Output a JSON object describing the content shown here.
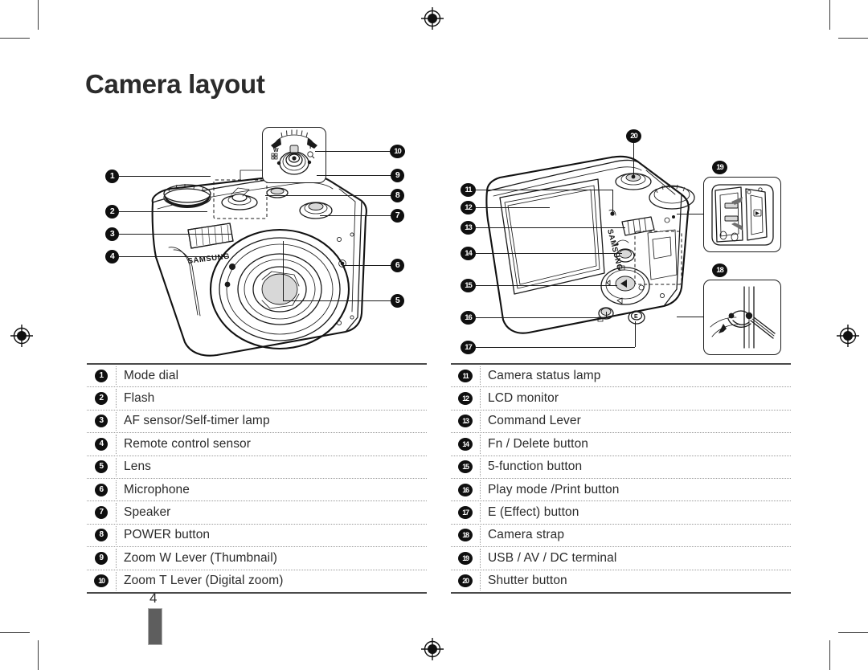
{
  "document": {
    "title": "Camera layout",
    "page_number": "4",
    "brand": "SAMSUNG"
  },
  "figures": {
    "front_view": {
      "name": "camera-front-view",
      "brand_label": "SAMSUNG",
      "zoom_inset": {
        "name": "zoom-lever-inset",
        "wide_label": "W",
        "tele_label": "T"
      }
    },
    "rear_view": {
      "name": "camera-rear-view",
      "brand_label": "SAMSUNG"
    },
    "terminal_inset": {
      "name": "usb-av-dc-terminal-inset",
      "callout": "19"
    },
    "strap_inset": {
      "name": "camera-strap-inset",
      "callout": "18"
    }
  },
  "callouts": {
    "front": [
      "1",
      "2",
      "3",
      "4",
      "5",
      "6",
      "7",
      "8",
      "9",
      "10"
    ],
    "rear": [
      "11",
      "12",
      "13",
      "14",
      "15",
      "16",
      "17",
      "18",
      "19",
      "20"
    ]
  },
  "parts_table": {
    "left_column": [
      {
        "number": "1",
        "label": "Mode dial"
      },
      {
        "number": "2",
        "label": "Flash"
      },
      {
        "number": "3",
        "label": "AF sensor/Self-timer lamp"
      },
      {
        "number": "4",
        "label": "Remote control sensor"
      },
      {
        "number": "5",
        "label": "Lens"
      },
      {
        "number": "6",
        "label": "Microphone"
      },
      {
        "number": "7",
        "label": "Speaker"
      },
      {
        "number": "8",
        "label": "POWER button"
      },
      {
        "number": "9",
        "label": "Zoom W Lever (Thumbnail)"
      },
      {
        "number": "10",
        "label": "Zoom T Lever (Digital zoom)"
      }
    ],
    "right_column": [
      {
        "number": "11",
        "label": "Camera status lamp"
      },
      {
        "number": "12",
        "label": "LCD monitor"
      },
      {
        "number": "13",
        "label": "Command Lever"
      },
      {
        "number": "14",
        "label": "Fn / Delete button"
      },
      {
        "number": "15",
        "label": "5-function button"
      },
      {
        "number": "16",
        "label": "Play mode /Print button"
      },
      {
        "number": "17",
        "label": "E (Effect) button"
      },
      {
        "number": "18",
        "label": "Camera strap"
      },
      {
        "number": "19",
        "label": "USB / AV / DC terminal"
      },
      {
        "number": "20",
        "label": "Shutter button"
      }
    ]
  },
  "colors": {
    "text": "#2b2b2b",
    "rule": "#4a4a4a",
    "badge_bg": "#0f0f0f",
    "badge_fg": "#ffffff",
    "tab_bar": "#5e5e5e"
  }
}
